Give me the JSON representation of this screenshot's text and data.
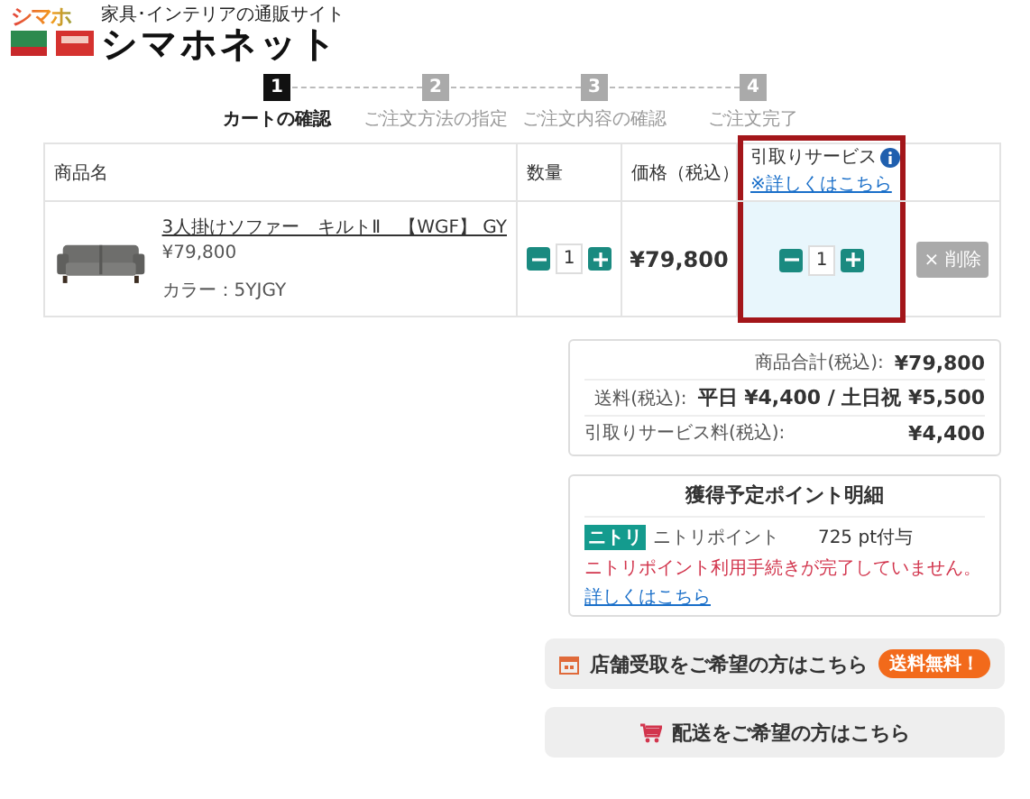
{
  "header": {
    "logo_badge": "シマホ",
    "tagline": "家具･インテリアの通販サイト",
    "logo_text": "シマホネット"
  },
  "steps": [
    {
      "number": "1",
      "label": "カートの確認",
      "selected": true
    },
    {
      "number": "2",
      "label": "ご注文方法の指定",
      "selected": false
    },
    {
      "number": "3",
      "label": "ご注文内容の確認",
      "selected": false
    },
    {
      "number": "4",
      "label": "ご注文完了",
      "selected": false
    }
  ],
  "cart": {
    "columns": [
      "商品名",
      "数量",
      "価格（税込）"
    ],
    "service_column": {
      "label": "引取りサービス",
      "link": "※詳しくはこちら",
      "highlighted": true
    },
    "items": [
      {
        "name": "3人掛けソファー　キルトⅡ　【WGF】 GY",
        "unit_price": "¥79,800",
        "color_label": "カラー：5YJGY",
        "quantity": "1",
        "price": "¥79,800",
        "service_quantity": "1",
        "delete": "× 削除"
      }
    ]
  },
  "summary": [
    {
      "label": "商品合計(税込):",
      "value": "¥79,800"
    },
    {
      "label": "送料(税込):",
      "value": "平日 ¥4,400 / 土日祝 ¥5,500"
    },
    {
      "label": "引取りサービス料(税込):",
      "value": "¥4,400"
    }
  ],
  "points": {
    "title": "獲得予定ポイント明細",
    "badge": "ニトリ",
    "label": "ニトリポイント",
    "value": "725 pt付与",
    "notice": "ニトリポイント利用手続きが完了していません。",
    "link": "詳しくはこちら"
  },
  "actions": [
    {
      "kind": "store",
      "label": "店舗受取をご希望の方はこちら",
      "badge": "送料無料！"
    },
    {
      "kind": "delivery",
      "label": "配送をご希望の方はこちら"
    }
  ]
}
